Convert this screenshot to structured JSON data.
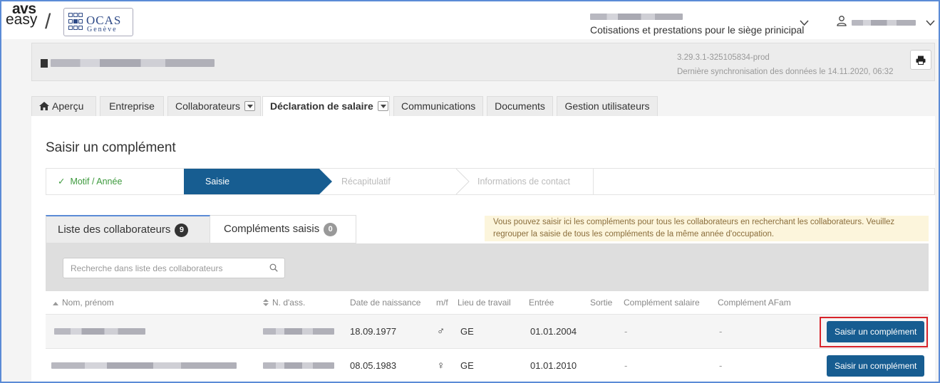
{
  "header": {
    "logo_left": {
      "line1": "avs",
      "line2": "easy"
    },
    "logo_slash": "/",
    "logo_ocas": {
      "title": "OCAS",
      "subtitle": "Genève"
    },
    "context_label": "Cotisations et prestations pour le siège prinicipal"
  },
  "company": {
    "version": "3.29.3.1-325105834-prod",
    "sync": "Dernière synchronisation des données le 14.11.2020, 06:32"
  },
  "tabs": [
    {
      "label": "Aperçu"
    },
    {
      "label": "Entreprise"
    },
    {
      "label": "Collaborateurs"
    },
    {
      "label": "Déclaration de salaire"
    },
    {
      "label": "Communications"
    },
    {
      "label": "Documents"
    },
    {
      "label": "Gestion utilisateurs"
    }
  ],
  "page": {
    "title": "Saisir un complément"
  },
  "steps": [
    {
      "label": "Motif / Année",
      "check": "✓"
    },
    {
      "label": "Saisie"
    },
    {
      "label": "Récapitulatif"
    },
    {
      "label": "Informations de contact"
    }
  ],
  "list_tabs": [
    {
      "label": "Liste des collaborateurs",
      "count": "9"
    },
    {
      "label": "Compléments saisis",
      "count": "0"
    }
  ],
  "info_text": "Vous pouvez saisir ici les compléments pour tous les collaborateurs en recherchant les collaborateurs. Veuillez regrouper la saisie de tous les compléments de la même année d'occupation.",
  "search": {
    "placeholder": "Recherche dans liste des collaborateurs"
  },
  "table": {
    "columns": [
      "Nom, prénom",
      "N. d'ass.",
      "Date de naissance",
      "m/f",
      "Lieu de travail",
      "Entrée",
      "Sortie",
      "Complément salaire",
      "Complément AFam"
    ],
    "rows": [
      {
        "birth": "18.09.1977",
        "sex": "♂",
        "work": "GE",
        "entry": "01.01.2004",
        "exit": "",
        "c_salary": "-",
        "c_afam": "-",
        "action": "Saisir un complément"
      },
      {
        "birth": "08.05.1983",
        "sex": "♀",
        "work": "GE",
        "entry": "01.01.2010",
        "exit": "",
        "c_salary": "-",
        "c_afam": "-",
        "action": "Saisir un complément"
      }
    ]
  },
  "colors": {
    "primary": "#175d91",
    "success": "#3d9a3d",
    "highlight": "#d8232a",
    "info_bg": "#fcf5dc"
  }
}
